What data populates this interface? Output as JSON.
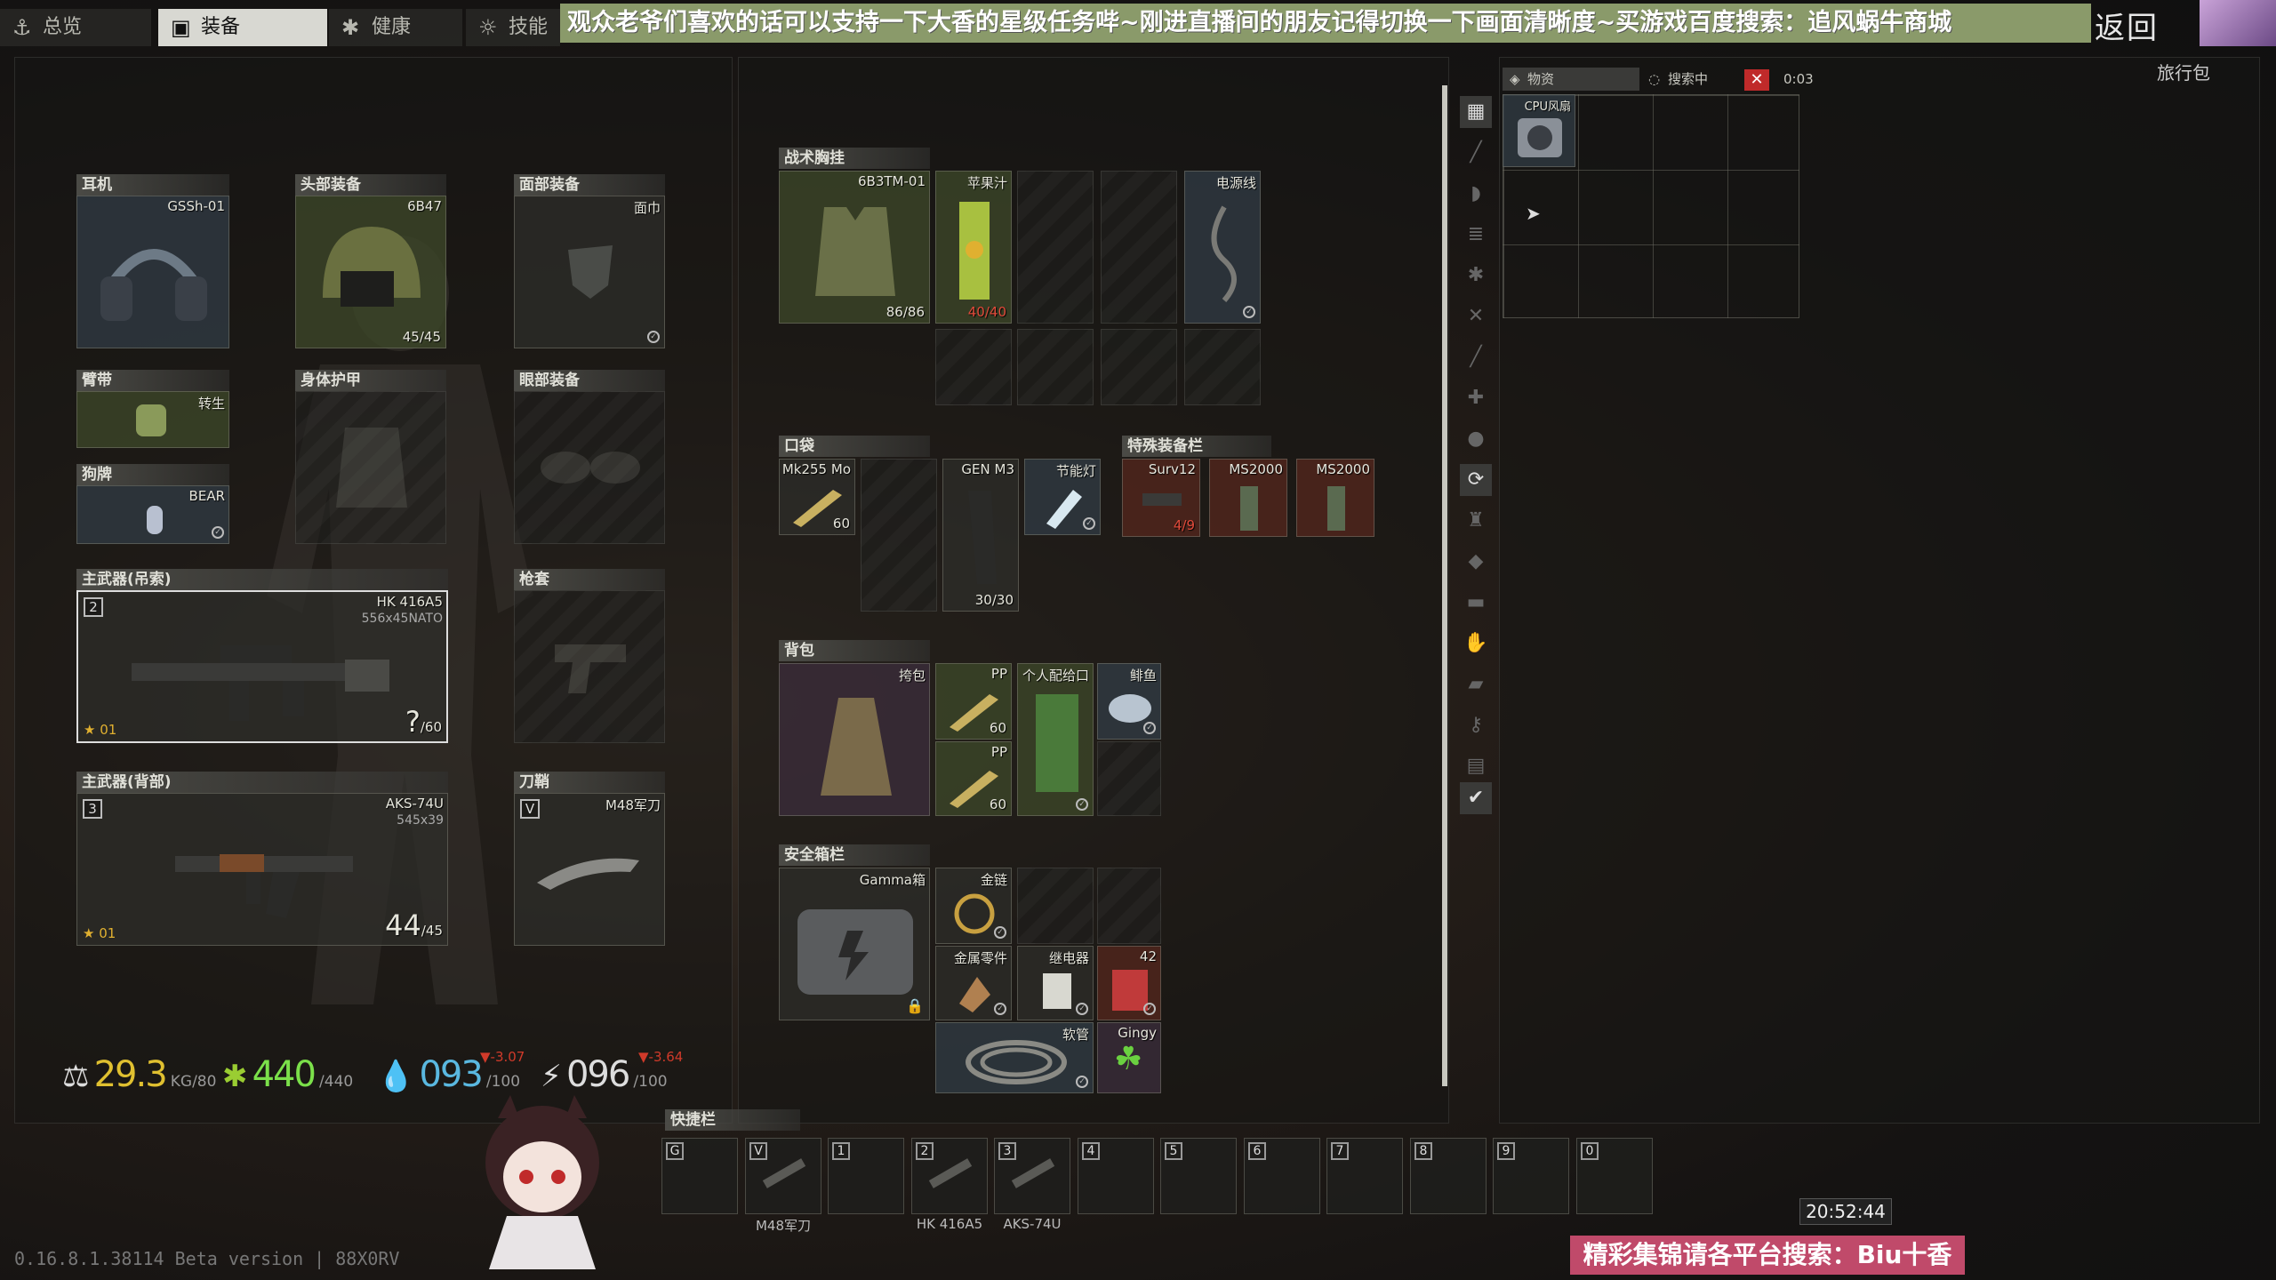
{
  "nav": {
    "tabs": [
      {
        "label": "总览",
        "icon": "anchor-icon"
      },
      {
        "label": "装备",
        "icon": "vest-icon"
      },
      {
        "label": "健康",
        "icon": "health-icon"
      },
      {
        "label": "技能",
        "icon": "sun-icon"
      }
    ],
    "active_tab": "装备",
    "banner": "观众老爷们喜欢的话可以支持一下大香的星级任务哔~刚进直播间的朋友记得切换一下画面清晰度~买游戏百度搜索：追风蜗牛商城",
    "back": "返回"
  },
  "gear": {
    "earpiece": {
      "title": "耳机",
      "item": "GSSh-01"
    },
    "headwear": {
      "title": "头部装备",
      "item": "6B47",
      "durability": "45/45"
    },
    "face": {
      "title": "面部装备",
      "item": "面巾"
    },
    "armband": {
      "title": "臂带",
      "item": "转生"
    },
    "armor": {
      "title": "身体护甲"
    },
    "eyewear": {
      "title": "眼部装备"
    },
    "dogtag": {
      "title": "狗牌",
      "item": "BEAR"
    },
    "primary1": {
      "title": "主武器(吊索)",
      "key": "2",
      "item": "HK 416A5",
      "ammo": "556x45NATO",
      "count": "?",
      "max": "/60",
      "rank": "01"
    },
    "holster": {
      "title": "枪套"
    },
    "primary2": {
      "title": "主武器(背部)",
      "key": "3",
      "item": "AKS-74U",
      "ammo": "545x39",
      "count": "44",
      "max": "/45",
      "rank": "01"
    },
    "scabbard": {
      "title": "刀鞘",
      "key": "V",
      "item": "M48军刀"
    }
  },
  "rig": {
    "title": "战术胸挂",
    "vest": {
      "item": "6B3TM-01",
      "durability": "86/86"
    },
    "juice": {
      "item": "苹果汁",
      "count": "40/40"
    },
    "cable": {
      "item": "电源线"
    }
  },
  "pockets": {
    "title": "口袋",
    "ammo": {
      "item": "Mk255 Mo",
      "count": "60"
    },
    "mag": {
      "item": "GEN M3",
      "count": "30/30"
    },
    "bulb": {
      "item": "节能灯"
    }
  },
  "special": {
    "title": "特殊装备栏",
    "items": [
      {
        "item": "Surv12",
        "count": "4/9"
      },
      {
        "item": "MS2000"
      },
      {
        "item": "MS2000"
      }
    ]
  },
  "backpack": {
    "title": "背包",
    "pack": {
      "item": "挎包"
    },
    "pp1": {
      "item": "PP",
      "count": "60"
    },
    "pp2": {
      "item": "PP",
      "count": "60"
    },
    "ration": {
      "item": "个人配给口"
    },
    "fish": {
      "item": "鲱鱼"
    }
  },
  "secure": {
    "title": "安全箱栏",
    "case": {
      "item": "Gamma箱"
    },
    "chain": {
      "item": "金链"
    },
    "parts": {
      "item": "金属零件"
    },
    "relay": {
      "item": "继电器"
    },
    "red": {
      "item": "42"
    },
    "hose": {
      "item": "软管"
    },
    "gingy": {
      "item": "Gingy"
    }
  },
  "stats": {
    "weight": {
      "value": "29.3",
      "unit": "KG",
      "max": "/80"
    },
    "health": {
      "value": "440",
      "max": "/440"
    },
    "hydration": {
      "value": "093",
      "max": "/100",
      "delta": "▼-3.07"
    },
    "energy": {
      "value": "096",
      "max": "/100",
      "delta": "▼-3.64"
    }
  },
  "quickbar": {
    "title": "快捷栏",
    "slots": [
      {
        "key": "G",
        "label": ""
      },
      {
        "key": "V",
        "label": "M48军刀"
      },
      {
        "key": "1",
        "label": ""
      },
      {
        "key": "2",
        "label": "HK 416A5"
      },
      {
        "key": "3",
        "label": "AKS-74U"
      },
      {
        "key": "4",
        "label": ""
      },
      {
        "key": "5",
        "label": ""
      },
      {
        "key": "6",
        "label": ""
      },
      {
        "key": "7",
        "label": ""
      },
      {
        "key": "8",
        "label": ""
      },
      {
        "key": "9",
        "label": ""
      },
      {
        "key": "0",
        "label": ""
      }
    ]
  },
  "loot": {
    "tab": "物资",
    "status": "搜索中",
    "count": "0:03",
    "title": "旅行包",
    "item": "CPU风扇"
  },
  "footer": {
    "version": "0.16.8.1.38114 Beta version | 88X0RV",
    "clock": "20:52:44",
    "promo": "精彩集锦请各平台搜索：Biu十香"
  },
  "colors": {
    "banner": "#8a9a6a",
    "promo": "#c04a6a",
    "accent_green": "#9acd32",
    "alert_red": "#d03a2a",
    "health_green": "#7be04a",
    "water_blue": "#5ab8e0"
  }
}
